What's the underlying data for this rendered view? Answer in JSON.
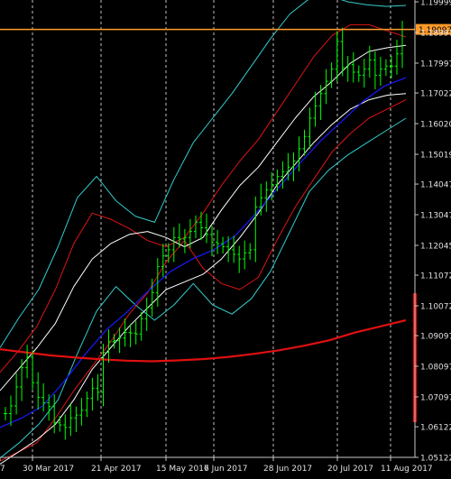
{
  "chart_data": {
    "type": "line",
    "instrument_note": "",
    "current_price": "1.19097",
    "y_ticks": [
      "1.19999",
      "1.18997",
      "1.17997",
      "1.17022",
      "1.16020",
      "1.15019",
      "1.14047",
      "1.13047",
      "1.12045",
      "1.11072",
      "1.10072",
      "1.09097",
      "1.08097",
      "1.07097",
      "1.06122",
      "1.05122"
    ],
    "ylim": [
      1.05122,
      1.19999
    ],
    "x_ticks": [
      "7",
      "30 Mar 2017",
      "21 Apr 2017",
      "15 May 2017",
      "6 Jun 2017",
      "28 Jun 2017",
      "20 Jul 2017",
      "11 Aug 2017"
    ],
    "grid": "vertical-dashed",
    "series": [
      {
        "role": "price",
        "color": "#00ff00",
        "values": [
          1.0655,
          1.068,
          1.0742,
          1.0805,
          1.084,
          1.0756,
          1.0708,
          1.069,
          1.0678,
          1.0625,
          1.0618,
          1.061,
          1.0641,
          1.065,
          1.0666,
          1.0705,
          1.0738,
          1.0725,
          1.0855,
          1.089,
          1.0893,
          1.0902,
          1.092,
          1.0918,
          1.0915,
          1.0965,
          1.1,
          1.105,
          1.1135,
          1.117,
          1.119,
          1.123,
          1.1225,
          1.123,
          1.125,
          1.128,
          1.1262,
          1.124,
          1.1215,
          1.121,
          1.12,
          1.119,
          1.1175,
          1.116,
          1.118,
          1.119,
          1.133,
          1.136,
          1.1385,
          1.1403,
          1.143,
          1.1445,
          1.146,
          1.148,
          1.152,
          1.156,
          1.162,
          1.166,
          1.17,
          1.174,
          1.178,
          1.187,
          1.1785,
          1.1795,
          1.177,
          1.176,
          1.178,
          1.181,
          1.176,
          1.178,
          1.179,
          1.179,
          1.183,
          1.191
        ]
      },
      {
        "role": "moving-average-long",
        "color": "#e01010",
        "values": [
          1.0865,
          1.0855,
          1.0845,
          1.0838,
          1.0832,
          1.0828,
          1.0826,
          1.0829,
          1.0833,
          1.084,
          1.085,
          1.0862,
          1.0877,
          1.0895,
          1.092,
          1.094,
          1.096
        ]
      },
      {
        "role": "moving-average-middle",
        "color": "#1a1aff",
        "values": [
          1.061,
          1.064,
          1.068,
          1.076,
          1.085,
          1.093,
          1.099,
          1.106,
          1.112,
          1.116,
          1.119,
          1.1235,
          1.131,
          1.139,
          1.147,
          1.1545,
          1.161,
          1.1675,
          1.1725,
          1.1752
        ]
      },
      {
        "role": "envelope-inner",
        "color": "#ffffff",
        "values_upper": [
          1.073,
          1.08,
          1.087,
          1.095,
          1.107,
          1.116,
          1.121,
          1.124,
          1.125,
          1.123,
          1.12,
          1.123,
          1.132,
          1.14,
          1.146,
          1.154,
          1.162,
          1.169,
          1.174,
          1.18,
          1.1838,
          1.185,
          1.1858
        ],
        "values_lower": [
          1.049,
          1.053,
          1.057,
          1.062,
          1.07,
          1.08,
          1.087,
          1.094,
          1.1,
          1.106,
          1.1085,
          1.111,
          1.116,
          1.123,
          1.131,
          1.14,
          1.147,
          1.154,
          1.16,
          1.165,
          1.168,
          1.1695,
          1.17
        ]
      },
      {
        "role": "envelope-middle",
        "color": "#dd1515",
        "values_upper": [
          1.079,
          1.086,
          1.094,
          1.106,
          1.121,
          1.131,
          1.129,
          1.126,
          1.122,
          1.12,
          1.123,
          1.131,
          1.14,
          1.148,
          1.155,
          1.164,
          1.173,
          1.182,
          1.189,
          1.1925,
          1.1925,
          1.1905,
          1.1885
        ],
        "values_lower": [
          1.05,
          1.053,
          1.056,
          1.064,
          1.073,
          1.081,
          1.089,
          1.098,
          1.105,
          1.115,
          1.122,
          1.113,
          1.108,
          1.106,
          1.11,
          1.122,
          1.133,
          1.142,
          1.151,
          1.157,
          1.162,
          1.165,
          1.168
        ]
      },
      {
        "role": "envelope-outer",
        "color": "#33cccc",
        "values_upper": [
          1.087,
          1.097,
          1.106,
          1.12,
          1.136,
          1.143,
          1.135,
          1.13,
          1.128,
          1.142,
          1.154,
          1.162,
          1.17,
          1.179,
          1.188,
          1.196,
          1.201,
          1.202,
          1.2,
          1.199,
          1.1985,
          1.1988
        ],
        "values_lower": [
          1.051,
          1.056,
          1.062,
          1.07,
          1.085,
          1.099,
          1.107,
          1.101,
          1.096,
          1.101,
          1.108,
          1.101,
          1.098,
          1.103,
          1.112,
          1.125,
          1.138,
          1.145,
          1.15,
          1.154,
          1.158,
          1.162
        ]
      }
    ]
  }
}
